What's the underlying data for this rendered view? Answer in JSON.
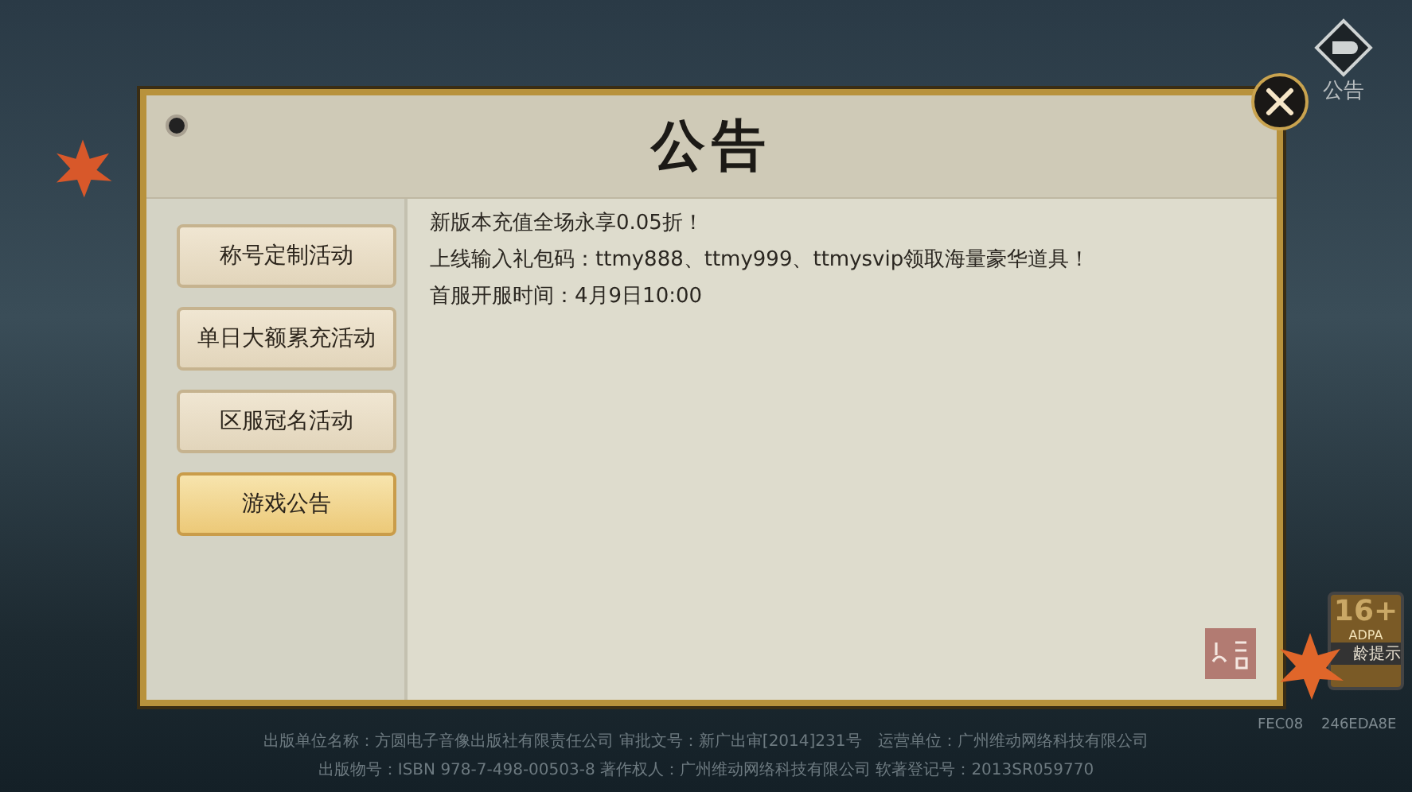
{
  "top_icon": {
    "label": "公告"
  },
  "dialog": {
    "title": "公告",
    "menu": [
      {
        "label": "称号定制活动",
        "selected": false
      },
      {
        "label": "单日大额累充活动",
        "selected": false
      },
      {
        "label": "区服冠名活动",
        "selected": false
      },
      {
        "label": "游戏公告",
        "selected": true
      }
    ],
    "content": [
      "新版本充值全场永享0.05折！",
      "上线输入礼包码：ttmy888、ttmy999、ttmysvip领取海量豪华道具！",
      "首服开服时间：4月9日10:00"
    ]
  },
  "age_badge": {
    "rating": "16+",
    "org": "ADPA",
    "caption": "龄提示"
  },
  "code": [
    "FEC08",
    "246EDA8E"
  ],
  "footer": [
    "出版单位名称：方圆电子音像出版社有限责任公司 审批文号：新广出审[2014]231号　运营单位：广州维动网络科技有限公司",
    "出版物号：ISBN 978-7-498-00503-8 著作权人：广州维动网络科技有限公司 软著登记号：2013SR059770"
  ]
}
